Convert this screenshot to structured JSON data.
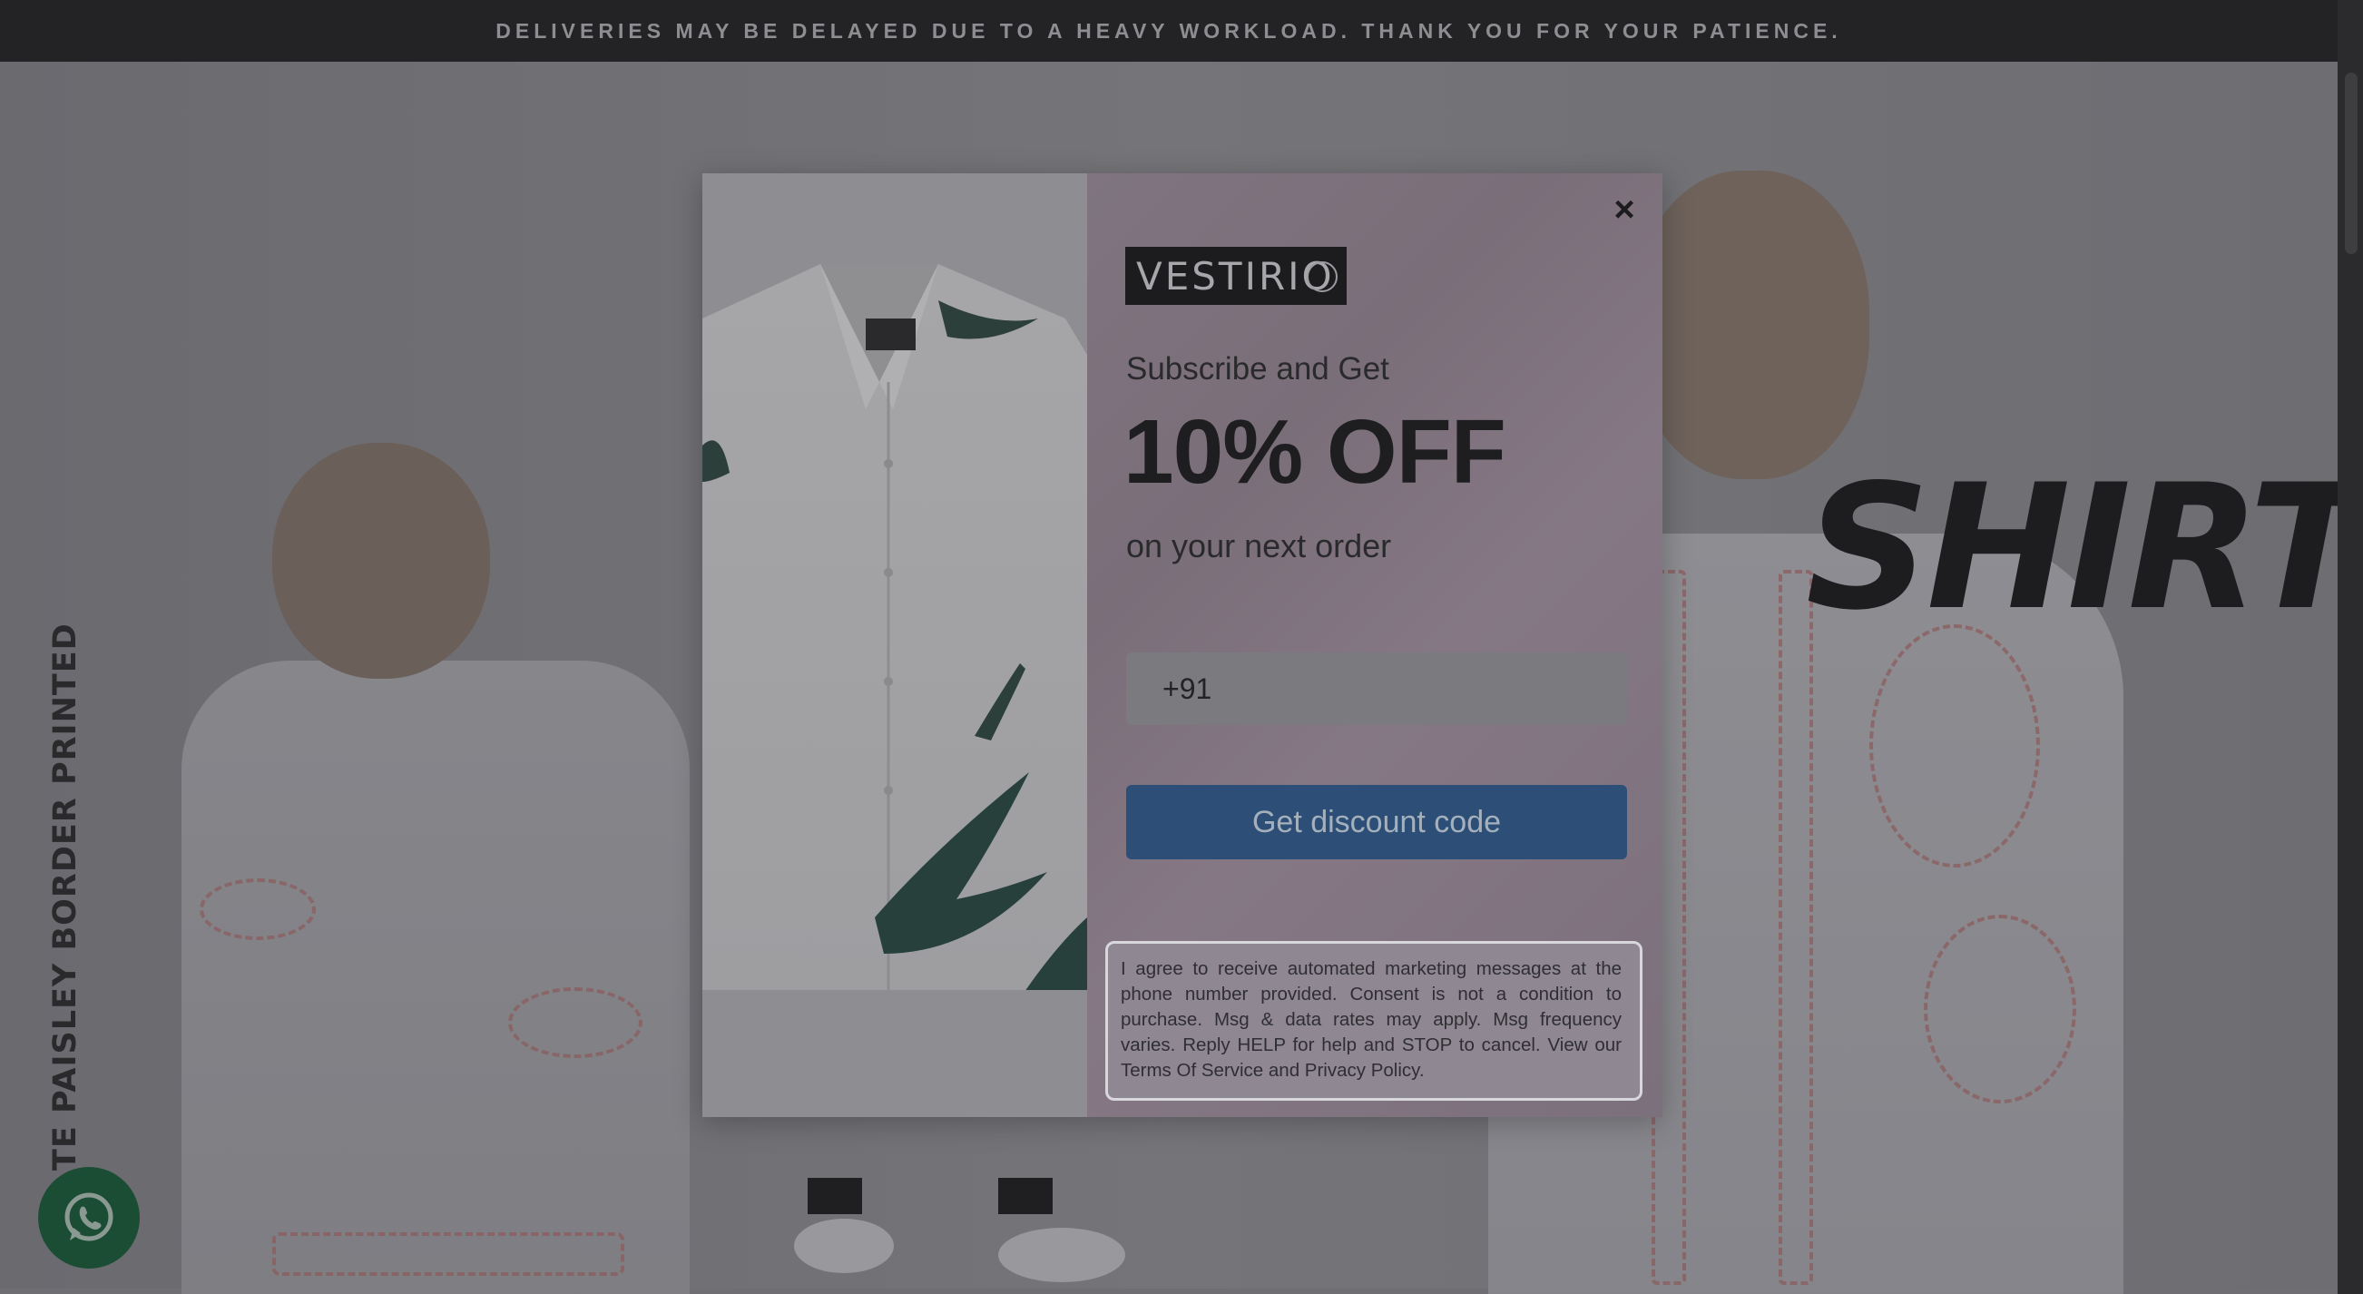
{
  "announcement": {
    "text": "DELIVERIES MAY BE DELAYED DUE TO A HEAVY WORKLOAD. THANK YOU FOR YOUR PATIENCE."
  },
  "hero": {
    "vertical_text": "TE PAISLEY BORDER PRINTED",
    "headline_word": "SHIRT"
  },
  "modal": {
    "logo_text": "VESTIRIO",
    "subtitle": "Subscribe and Get",
    "headline": "10% OFF",
    "tagline": "on your next order",
    "phone_value": "+91",
    "cta_label": "Get discount code",
    "consent_text": "I agree to receive automated marketing messages at the phone number provided. Consent is not a condition to purchase. Msg & data rates may apply. Msg frequency varies. Reply HELP for help and STOP to cancel. View our Terms Of Service and Privacy Policy.",
    "close_icon": "×"
  },
  "icons": {
    "close": "close-icon",
    "whatsapp": "whatsapp-icon"
  },
  "colors": {
    "announcement_bg": "#232325",
    "cta_bg": "#2d4f77",
    "whatsapp_bg": "#1b4d35"
  }
}
